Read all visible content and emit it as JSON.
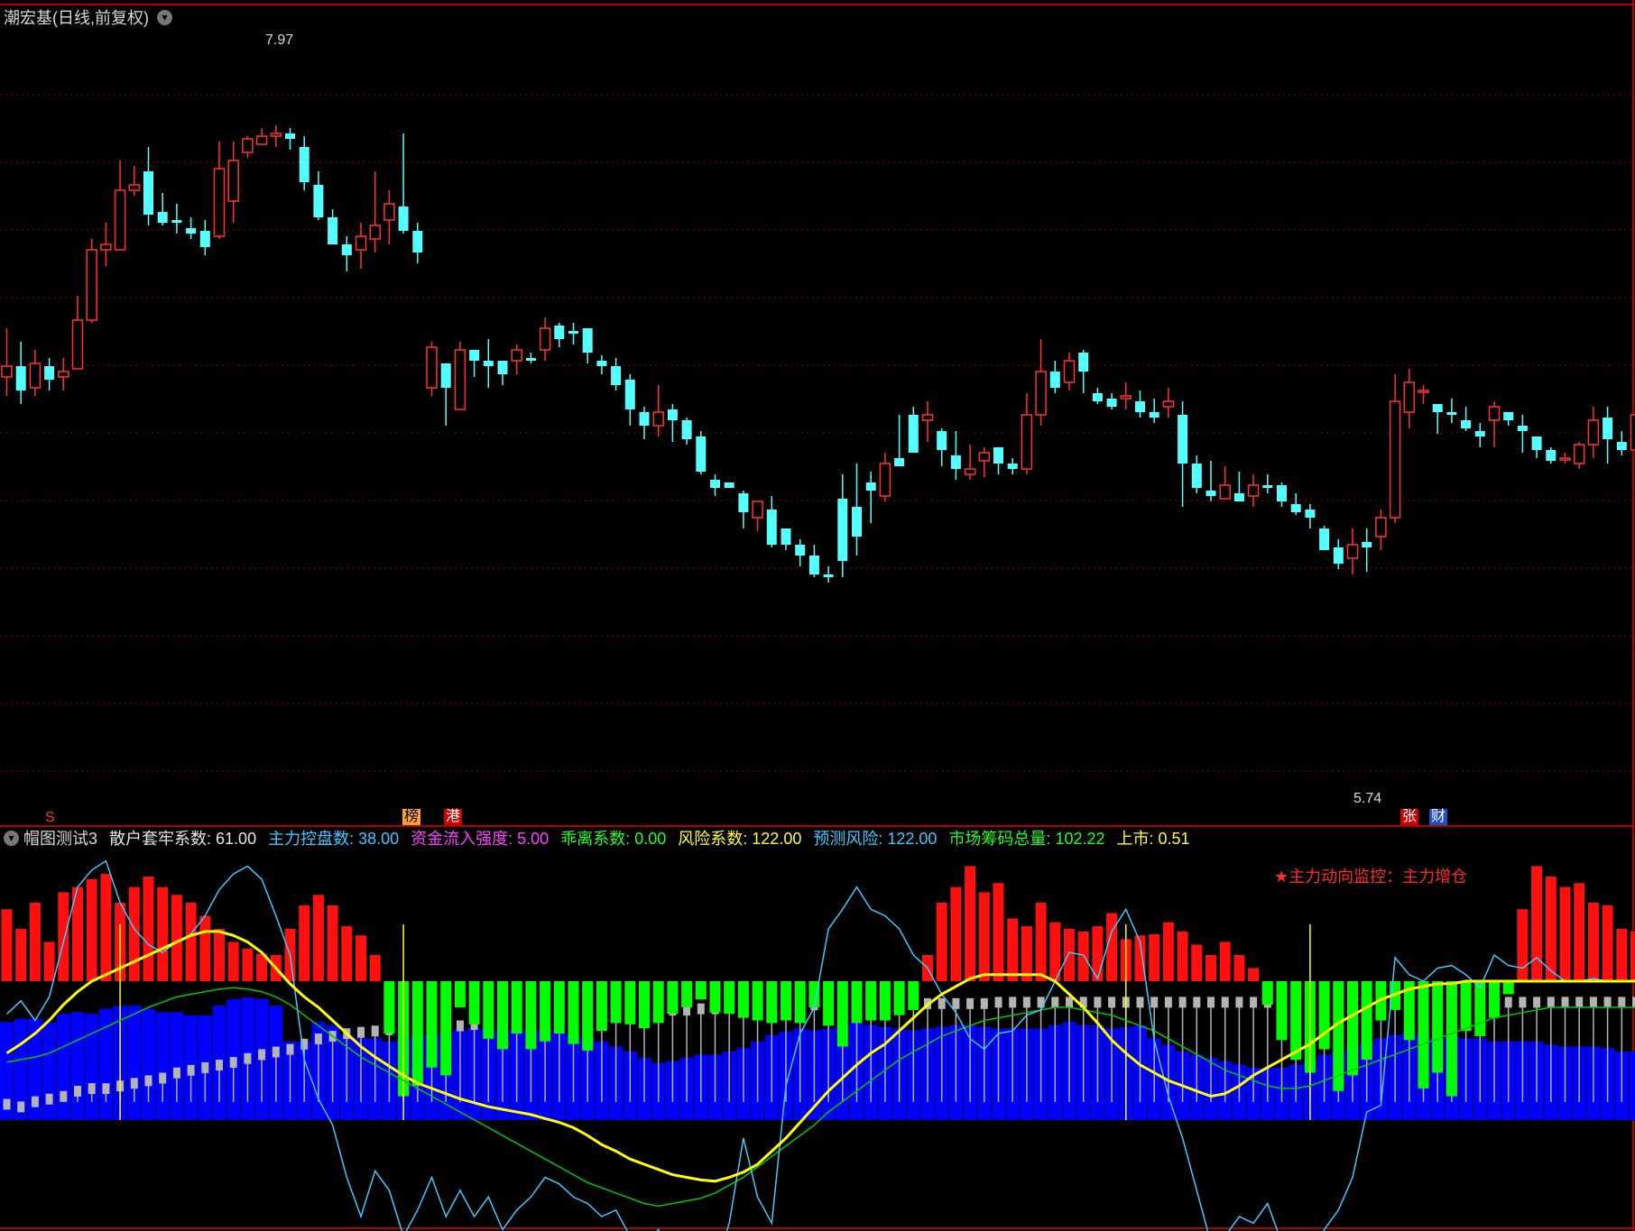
{
  "window": {
    "title": "潮宏基(日线,前复权)",
    "caret_icon": "chevron-down-icon"
  },
  "price_panel": {
    "high_label": "7.97",
    "low_label": "5.74",
    "price_range": [
      5.5,
      8.3
    ]
  },
  "markers": {
    "s": "S",
    "bang": "榜",
    "gang": "港",
    "zhang": "张",
    "cai": "财"
  },
  "indicator": {
    "name": "帽图测试3",
    "items": [
      {
        "label": "散户套牢系数: 61.00",
        "color": "#e6e6e6"
      },
      {
        "label": "主力控盘数: 38.00",
        "color": "#3ec8ff"
      },
      {
        "label": "资金流入强度: 5.00",
        "color": "#ff40ff"
      },
      {
        "label": "乖离系数: 0.00",
        "color": "#20ff20"
      },
      {
        "label": "风险系数: 122.00",
        "color": "#ffff20"
      },
      {
        "label": "预测风险: 122.00",
        "color": "#3ec8ff"
      },
      {
        "label": "市场筹码总量: 102.22",
        "color": "#20ff20"
      },
      {
        "label": "上市: 0.51",
        "color": "#ffff20"
      }
    ],
    "monitor": "★主力动向监控：主力增仓"
  },
  "colors": {
    "up": "#ff3232",
    "down": "#54ffff",
    "grid": "#8b0000",
    "hist_pos": "#ff1010",
    "hist_neg": "#00ff00",
    "blue": "#0000ff",
    "gray": "#b4b4b4",
    "yellow": "#ffff00",
    "cyan": "#40c8ff",
    "green": "#00c800"
  },
  "chart_data": {
    "type": "candlestick",
    "candles": [
      [
        7.04,
        7.08,
        7.22,
        6.97
      ],
      [
        7.08,
        6.99,
        7.17,
        6.94
      ],
      [
        7.0,
        7.09,
        7.14,
        6.97
      ],
      [
        7.08,
        7.03,
        7.11,
        6.99
      ],
      [
        7.04,
        7.06,
        7.11,
        6.99
      ],
      [
        7.07,
        7.25,
        7.34,
        7.07
      ],
      [
        7.25,
        7.51,
        7.55,
        7.24
      ],
      [
        7.51,
        7.53,
        7.61,
        7.45
      ],
      [
        7.51,
        7.73,
        7.84,
        7.51
      ],
      [
        7.73,
        7.75,
        7.82,
        7.71
      ],
      [
        7.8,
        7.64,
        7.89,
        7.6
      ],
      [
        7.65,
        7.61,
        7.72,
        7.6
      ],
      [
        7.62,
        7.61,
        7.68,
        7.57
      ],
      [
        7.59,
        7.57,
        7.63,
        7.55
      ],
      [
        7.58,
        7.52,
        7.62,
        7.49
      ],
      [
        7.56,
        7.81,
        7.91,
        7.55
      ],
      [
        7.69,
        7.84,
        7.91,
        7.61
      ],
      [
        7.87,
        7.92,
        7.93,
        7.85
      ],
      [
        7.9,
        7.93,
        7.96,
        7.9
      ],
      [
        7.93,
        7.94,
        7.97,
        7.89
      ],
      [
        7.94,
        7.92,
        7.96,
        7.88
      ],
      [
        7.89,
        7.76,
        7.93,
        7.73
      ],
      [
        7.75,
        7.63,
        7.8,
        7.62
      ],
      [
        7.63,
        7.53,
        7.66,
        7.53
      ],
      [
        7.53,
        7.49,
        7.56,
        7.43
      ],
      [
        7.51,
        7.56,
        7.61,
        7.44
      ],
      [
        7.55,
        7.6,
        7.8,
        7.5
      ],
      [
        7.62,
        7.68,
        7.73,
        7.53
      ],
      [
        7.67,
        7.58,
        7.94,
        7.57
      ],
      [
        7.58,
        7.5,
        7.61,
        7.46
      ],
      [
        7.0,
        7.15,
        7.17,
        6.97
      ],
      [
        7.09,
        7.0,
        7.06,
        6.86
      ],
      [
        6.92,
        7.14,
        7.17,
        6.94
      ],
      [
        7.14,
        7.1,
        7.14,
        7.04
      ],
      [
        7.1,
        7.08,
        7.18,
        7.0
      ],
      [
        7.1,
        7.05,
        7.09,
        7.01
      ],
      [
        7.1,
        7.14,
        7.16,
        7.05
      ],
      [
        7.11,
        7.1,
        7.13,
        7.09
      ],
      [
        7.14,
        7.22,
        7.26,
        7.1
      ],
      [
        7.23,
        7.18,
        7.24,
        7.15
      ],
      [
        7.21,
        7.2,
        7.24,
        7.16
      ],
      [
        7.22,
        7.13,
        7.18,
        7.09
      ],
      [
        7.1,
        7.08,
        7.12,
        7.05
      ],
      [
        7.08,
        7.01,
        7.11,
        6.99
      ],
      [
        7.03,
        6.92,
        7.05,
        6.86
      ],
      [
        6.91,
        6.86,
        6.93,
        6.81
      ],
      [
        6.86,
        6.91,
        7.01,
        6.82
      ],
      [
        6.92,
        6.88,
        6.94,
        6.8
      ],
      [
        6.88,
        6.81,
        6.89,
        6.79
      ],
      [
        6.82,
        6.69,
        6.84,
        6.68
      ],
      [
        6.66,
        6.63,
        6.68,
        6.6
      ],
      [
        6.65,
        6.63,
        6.65,
        6.63
      ],
      [
        6.61,
        6.54,
        6.62,
        6.48
      ],
      [
        6.52,
        6.58,
        6.58,
        6.47
      ],
      [
        6.55,
        6.42,
        6.6,
        6.41
      ],
      [
        6.48,
        6.42,
        6.41,
        6.4
      ],
      [
        6.42,
        6.38,
        6.44,
        6.34
      ],
      [
        6.38,
        6.31,
        6.42,
        6.3
      ],
      [
        6.31,
        6.3,
        6.34,
        6.28
      ],
      [
        6.59,
        6.36,
        6.68,
        6.3
      ],
      [
        6.56,
        6.45,
        6.72,
        6.38
      ],
      [
        6.65,
        6.62,
        6.69,
        6.5
      ],
      [
        6.6,
        6.72,
        6.76,
        6.58
      ],
      [
        6.74,
        6.71,
        6.9,
        6.74
      ],
      [
        6.9,
        6.76,
        6.93,
        6.8
      ],
      [
        6.88,
        6.9,
        6.95,
        6.8
      ],
      [
        6.84,
        6.77,
        6.85,
        6.71
      ],
      [
        6.75,
        6.7,
        6.84,
        6.66
      ],
      [
        6.68,
        6.7,
        6.79,
        6.66
      ],
      [
        6.73,
        6.76,
        6.78,
        6.67
      ],
      [
        6.78,
        6.72,
        6.77,
        6.68
      ],
      [
        6.72,
        6.7,
        6.74,
        6.68
      ],
      [
        6.7,
        6.9,
        6.98,
        6.68
      ],
      [
        6.9,
        7.06,
        7.18,
        6.86
      ],
      [
        7.06,
        7.0,
        7.1,
        6.98
      ],
      [
        7.02,
        7.1,
        7.13,
        6.99
      ],
      [
        7.13,
        7.06,
        7.14,
        6.98
      ],
      [
        6.98,
        6.95,
        7.0,
        6.94
      ],
      [
        6.96,
        6.93,
        6.98,
        6.92
      ],
      [
        6.96,
        6.97,
        7.02,
        6.92
      ],
      [
        6.95,
        6.91,
        6.99,
        6.89
      ],
      [
        6.91,
        6.89,
        6.96,
        6.87
      ],
      [
        6.93,
        6.95,
        7.0,
        6.89
      ],
      [
        6.9,
        6.72,
        6.95,
        6.56
      ],
      [
        6.72,
        6.63,
        6.75,
        6.61
      ],
      [
        6.62,
        6.6,
        6.73,
        6.58
      ],
      [
        6.59,
        6.64,
        6.71,
        6.6
      ],
      [
        6.61,
        6.58,
        6.69,
        6.58
      ],
      [
        6.6,
        6.64,
        6.68,
        6.56
      ],
      [
        6.64,
        6.63,
        6.68,
        6.61
      ],
      [
        6.64,
        6.58,
        6.65,
        6.56
      ],
      [
        6.57,
        6.54,
        6.61,
        6.53
      ],
      [
        6.55,
        6.52,
        6.57,
        6.48
      ],
      [
        6.48,
        6.4,
        6.49,
        6.4
      ],
      [
        6.41,
        6.35,
        6.44,
        6.33
      ],
      [
        6.37,
        6.42,
        6.48,
        6.31
      ],
      [
        6.43,
        6.41,
        6.48,
        6.32
      ],
      [
        6.45,
        6.52,
        6.55,
        6.4
      ],
      [
        6.52,
        6.95,
        7.05,
        6.5
      ],
      [
        6.91,
        7.02,
        7.07,
        6.85
      ],
      [
        6.99,
        6.99,
        7.01,
        6.94
      ],
      [
        6.94,
        6.91,
        6.93,
        6.83
      ],
      [
        6.91,
        6.9,
        6.96,
        6.87
      ],
      [
        6.88,
        6.85,
        6.93,
        6.84
      ],
      [
        6.84,
        6.82,
        6.87,
        6.78
      ],
      [
        6.88,
        6.93,
        6.95,
        6.78
      ],
      [
        6.91,
        6.88,
        6.91,
        6.86
      ],
      [
        6.86,
        6.84,
        6.9,
        6.76
      ],
      [
        6.82,
        6.77,
        6.82,
        6.74
      ],
      [
        6.77,
        6.73,
        6.78,
        6.72
      ],
      [
        6.74,
        6.74,
        6.76,
        6.72
      ],
      [
        6.72,
        6.79,
        6.8,
        6.7
      ],
      [
        6.79,
        6.88,
        6.93,
        6.74
      ],
      [
        6.89,
        6.81,
        6.93,
        6.72
      ],
      [
        6.8,
        6.77,
        6.84,
        6.75
      ],
      [
        6.77,
        6.9,
        6.95,
        6.77
      ]
    ],
    "histogram": [
      55,
      40,
      60,
      30,
      68,
      72,
      78,
      82,
      60,
      72,
      80,
      72,
      66,
      60,
      50,
      40,
      30,
      25,
      21,
      20,
      40,
      58,
      66,
      58,
      42,
      35,
      20,
      -40,
      -88,
      -80,
      -66,
      -72,
      -20,
      -33,
      -44,
      -52,
      -40,
      -52,
      -46,
      -40,
      -48,
      -53,
      -38,
      -32,
      -33,
      -36,
      -32,
      -25,
      -20,
      -14,
      -24,
      -25,
      -28,
      -30,
      -32,
      -30,
      -32,
      -20,
      -34,
      -50,
      -32,
      -30,
      -30,
      -26,
      -22,
      20,
      60,
      72,
      88,
      68,
      75,
      48,
      42,
      60,
      45,
      40,
      38,
      42,
      52,
      32,
      35,
      36,
      45,
      38,
      28,
      20,
      30,
      20,
      10,
      -18,
      -45,
      -60,
      -70,
      -52,
      -84,
      -72,
      -60,
      -30,
      -22,
      -45,
      -82,
      -70,
      -88,
      -38,
      -42,
      -28,
      -10,
      55,
      88,
      80,
      72,
      75,
      60,
      58,
      40,
      38,
      30,
      12,
      10,
      10
    ],
    "cyan_line": [
      -25,
      -15,
      -30,
      -12,
      30,
      72,
      85,
      92,
      60,
      40,
      28,
      22,
      30,
      36,
      50,
      70,
      82,
      88,
      78,
      50,
      20,
      -60,
      -90,
      -110,
      -150,
      -180,
      -145,
      -160,
      -195,
      -175,
      -150,
      -180,
      -160,
      -180,
      -165,
      -190,
      -175,
      -165,
      -150,
      -155,
      -165,
      -170,
      -180,
      -175,
      -195,
      -200,
      -190,
      -210,
      -205,
      -215,
      -220,
      -185,
      -120,
      -165,
      -185,
      -80,
      -40,
      -20,
      40,
      55,
      72,
      55,
      50,
      40,
      20,
      10,
      -10,
      -24,
      -44,
      -52,
      -40,
      -38,
      -26,
      -22,
      0,
      22,
      20,
      2,
      38,
      55,
      30,
      -45,
      -88,
      -120,
      -160,
      -200,
      -195,
      -180,
      -185,
      -170,
      -200,
      -220,
      -210,
      -190,
      -175,
      -150,
      -100,
      -95,
      18,
      5,
      0,
      10,
      12,
      5,
      -5,
      20,
      12,
      10,
      18,
      8,
      0,
      0,
      2,
      0,
      0,
      0,
      0,
      0,
      0,
      0
    ],
    "yellow_line": [
      -55,
      -48,
      -40,
      -30,
      -18,
      -8,
      0,
      5,
      10,
      15,
      20,
      25,
      30,
      35,
      38,
      38,
      35,
      30,
      22,
      10,
      -2,
      -12,
      -20,
      -30,
      -40,
      -50,
      -58,
      -65,
      -72,
      -78,
      -82,
      -86,
      -90,
      -93,
      -96,
      -98,
      -100,
      -102,
      -105,
      -108,
      -112,
      -118,
      -125,
      -130,
      -136,
      -140,
      -144,
      -148,
      -150,
      -152,
      -153,
      -150,
      -146,
      -140,
      -130,
      -120,
      -108,
      -96,
      -84,
      -74,
      -64,
      -55,
      -48,
      -38,
      -28,
      -18,
      -10,
      -4,
      2,
      5,
      5,
      5,
      5,
      5,
      0,
      -10,
      -20,
      -32,
      -45,
      -55,
      -64,
      -70,
      -76,
      -80,
      -84,
      -88,
      -86,
      -80,
      -72,
      -66,
      -60,
      -54,
      -48,
      -40,
      -32,
      -26,
      -20,
      -14,
      -10,
      -6,
      -4,
      -2,
      -2,
      0,
      0,
      0,
      0,
      0,
      0,
      0,
      0,
      0,
      0,
      0,
      0,
      0,
      0,
      0,
      0,
      0
    ],
    "green_line": [
      -62,
      -60,
      -58,
      -55,
      -50,
      -45,
      -40,
      -35,
      -30,
      -25,
      -20,
      -16,
      -12,
      -10,
      -8,
      -6,
      -5,
      -6,
      -8,
      -12,
      -18,
      -26,
      -34,
      -42,
      -50,
      -58,
      -64,
      -70,
      -76,
      -82,
      -88,
      -94,
      -100,
      -106,
      -112,
      -118,
      -124,
      -130,
      -136,
      -142,
      -148,
      -154,
      -158,
      -162,
      -166,
      -170,
      -172,
      -170,
      -168,
      -166,
      -162,
      -156,
      -150,
      -142,
      -134,
      -126,
      -118,
      -110,
      -100,
      -92,
      -84,
      -76,
      -68,
      -60,
      -54,
      -48,
      -42,
      -38,
      -34,
      -30,
      -28,
      -26,
      -24,
      -22,
      -20,
      -20,
      -22,
      -24,
      -26,
      -30,
      -34,
      -38,
      -44,
      -50,
      -56,
      -62,
      -68,
      -72,
      -76,
      -80,
      -82,
      -82,
      -80,
      -76,
      -72,
      -68,
      -64,
      -60,
      -56,
      -52,
      -48,
      -44,
      -40,
      -36,
      -32,
      -28,
      -26,
      -24,
      -22,
      -20,
      -20,
      -20,
      -20,
      -20,
      -20,
      -20,
      -20,
      -20,
      -20,
      -20
    ],
    "blue_bars": [
      60,
      62,
      62,
      60,
      65,
      66,
      65,
      68,
      70,
      70,
      68,
      66,
      66,
      64,
      64,
      70,
      74,
      75,
      74,
      70,
      48,
      48,
      60,
      58,
      52,
      50,
      50,
      48,
      50,
      52,
      52,
      54,
      55,
      56,
      56,
      56,
      55,
      55,
      56,
      54,
      52,
      50,
      48,
      45,
      42,
      38,
      35,
      36,
      38,
      40,
      40,
      42,
      44,
      48,
      52,
      54,
      56,
      55,
      56,
      58,
      60,
      58,
      57,
      56,
      55,
      56,
      57,
      58,
      58,
      57,
      56,
      56,
      56,
      56,
      58,
      60,
      58,
      58,
      56,
      57,
      58,
      50,
      46,
      42,
      40,
      38,
      36,
      34,
      32,
      32,
      32,
      34,
      36,
      40,
      42,
      45,
      48,
      50,
      52,
      54,
      52,
      50,
      52,
      50,
      50,
      48,
      48,
      48,
      48,
      46,
      45,
      45,
      45,
      44,
      42,
      42,
      40,
      40,
      40,
      42
    ],
    "gray_bars": [
      -90,
      -92,
      -88,
      -86,
      -84,
      -80,
      -78,
      -78,
      -76,
      -74,
      -72,
      -70,
      -66,
      -64,
      -62,
      -60,
      -58,
      -55,
      -52,
      -50,
      -48,
      -44,
      -40,
      -38,
      -36,
      -35,
      -34,
      -33,
      -32,
      -32,
      -31,
      -30,
      -30,
      -29,
      -28,
      -28,
      -27,
      -26,
      -25,
      -24,
      -23,
      -22,
      -21,
      -20,
      -19,
      -18,
      -18,
      -18,
      -18,
      -17,
      -17,
      -16,
      -16,
      -16,
      -16,
      -15,
      -15,
      -14,
      -14,
      -14,
      -14,
      -14,
      -14,
      -13,
      -13,
      -13,
      -13,
      -13,
      -13,
      -13,
      -12,
      -12,
      -12,
      -12,
      -12,
      -12,
      -12,
      -12,
      -12,
      -12,
      -12,
      -12,
      -12,
      -12,
      -12,
      -12,
      -12,
      -12,
      -12,
      -12,
      -12,
      -12,
      -12,
      -12,
      -12,
      -12,
      -12,
      -12,
      -12,
      -12,
      -12,
      -12,
      -12,
      -12,
      -12,
      -12,
      -12,
      -12,
      -12,
      -12,
      -12,
      -12,
      -12,
      -12,
      -12,
      -12,
      -12,
      -12,
      -12,
      -12
    ],
    "yellow_vlines": [
      8,
      28,
      79,
      92
    ]
  }
}
